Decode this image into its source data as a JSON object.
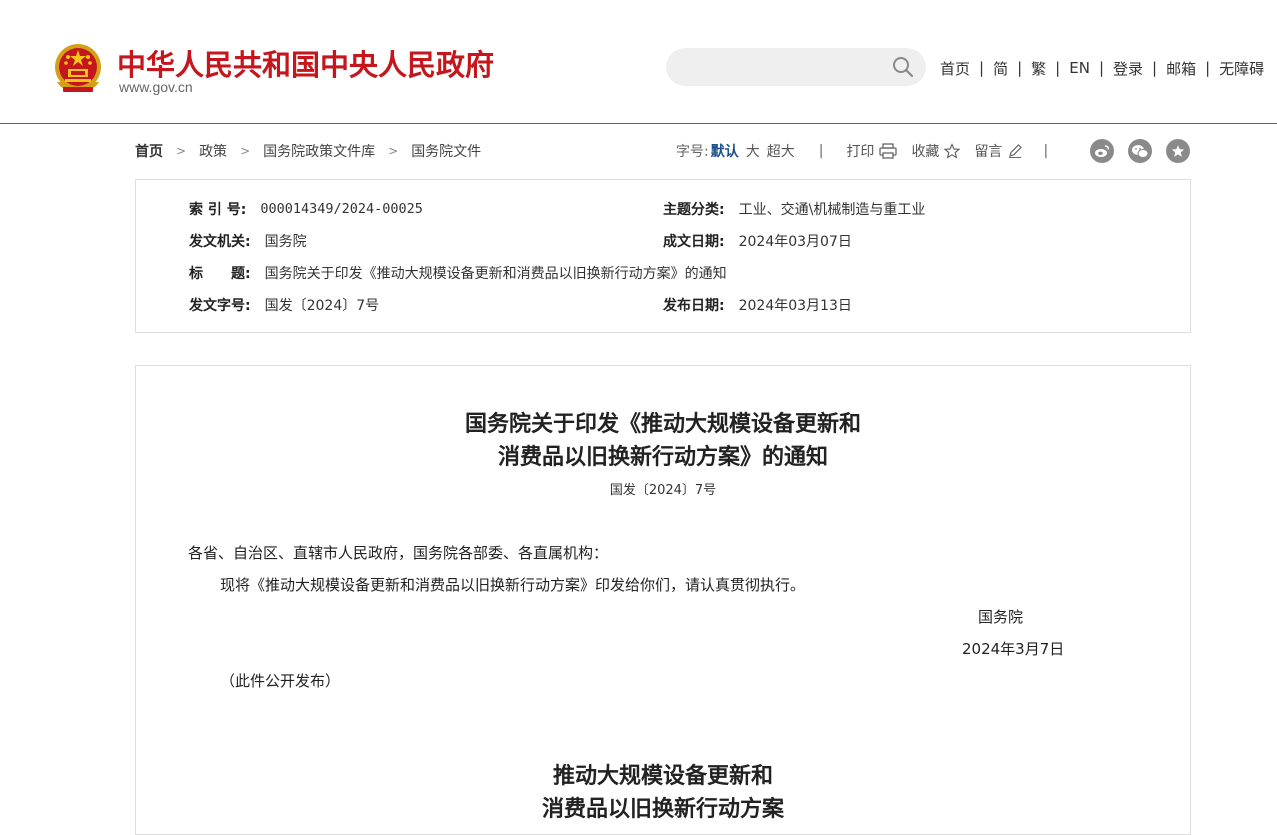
{
  "header": {
    "site_name": "中华人民共和国中央人民政府",
    "site_domain": "www.gov.cn",
    "search_placeholder": "",
    "nav": [
      "首页",
      "简",
      "繁",
      "EN",
      "登录",
      "邮箱",
      "无障碍"
    ]
  },
  "breadcrumb": [
    "首页",
    "政策",
    "国务院政策文件库",
    "国务院文件"
  ],
  "tools": {
    "font_size_label": "字号:",
    "font_sizes": [
      "默认",
      "大",
      "超大"
    ],
    "active_font_size": "默认",
    "print": "打印",
    "favorite": "收藏",
    "comment": "留言"
  },
  "info": {
    "index_no_label": "索 引 号:",
    "index_no": "000014349/2024-00025",
    "category_label": "主题分类:",
    "category": "工业、交通\\机械制造与重工业",
    "issuer_label": "发文机关:",
    "issuer": "国务院",
    "written_date_label": "成文日期:",
    "written_date": "2024年03月07日",
    "title_label": "标　　题:",
    "title": "国务院关于印发《推动大规模设备更新和消费品以旧换新行动方案》的通知",
    "doc_no_label": "发文字号:",
    "doc_no": "国发〔2024〕7号",
    "publish_date_label": "发布日期:",
    "publish_date": "2024年03月13日"
  },
  "article": {
    "title_line1": "国务院关于印发《推动大规模设备更新和",
    "title_line2": "消费品以旧换新行动方案》的通知",
    "doc_no": "国发〔2024〕7号",
    "addressee": "各省、自治区、直辖市人民政府，国务院各部委、各直属机构：",
    "body": "现将《推动大规模设备更新和消费品以旧换新行动方案》印发给你们，请认真贯彻执行。",
    "signer": "国务院",
    "date": "2024年3月7日",
    "note": "（此件公开发布）",
    "sub_title_line1": "推动大规模设备更新和",
    "sub_title_line2": "消费品以旧换新行动方案"
  },
  "colors": {
    "brand_red": "#c4161c",
    "header_rule": "#4a6a7f",
    "active_link": "#1a4f8a",
    "share_icon_bg": "#8a8a8a"
  },
  "icons": [
    "national-emblem",
    "search-icon",
    "print-icon",
    "star-icon",
    "pencil-icon",
    "weibo-icon",
    "wechat-icon",
    "favorite-star-icon"
  ]
}
